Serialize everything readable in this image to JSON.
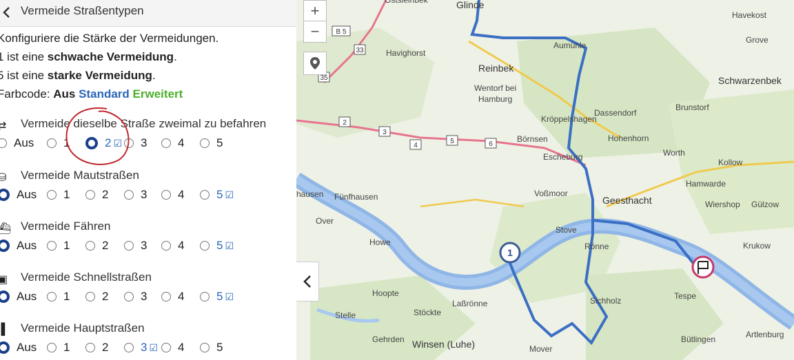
{
  "header": {
    "title": "Vermeide Straßentypen"
  },
  "intro": {
    "line1": "Konfiguriere die Stärke der Vermeidungen.",
    "line2_pre": "1 ist eine ",
    "line2_bold": "schwache Vermeidung",
    "line2_post": ".",
    "line3_pre": "5 ist eine ",
    "line3_bold": "starke Vermeidung",
    "line3_post": ".",
    "colorcode_label": "Farbcode: ",
    "colorcode_off": "Aus",
    "colorcode_standard": "Standard",
    "colorcode_extended": "Erweitert"
  },
  "sections": [
    {
      "title": "Vermeide dieselbe Straße zweimal zu befahren",
      "icon": "u-turn-icon",
      "selected": "2",
      "checked": "2",
      "options": [
        "Aus",
        "1",
        "2",
        "3",
        "4",
        "5"
      ]
    },
    {
      "title": "Vermeide Mautstraßen",
      "icon": "toll-icon",
      "selected": "Aus",
      "checked": "5",
      "options": [
        "Aus",
        "1",
        "2",
        "3",
        "4",
        "5"
      ]
    },
    {
      "title": "Vermeide Fähren",
      "icon": "ferry-icon",
      "selected": "Aus",
      "checked": "5",
      "options": [
        "Aus",
        "1",
        "2",
        "3",
        "4",
        "5"
      ]
    },
    {
      "title": "Vermeide Schnellstraßen",
      "icon": "car-icon",
      "selected": "Aus",
      "checked": "5",
      "options": [
        "Aus",
        "1",
        "2",
        "3",
        "4",
        "5"
      ]
    },
    {
      "title": "Vermeide Hauptstraßen",
      "icon": "road-icon",
      "selected": "Aus",
      "checked": "3",
      "options": [
        "Aus",
        "1",
        "2",
        "3",
        "4",
        "5"
      ]
    }
  ],
  "map": {
    "zoom_in": "+",
    "zoom_out": "−",
    "waypoint_label": "1",
    "places": [
      "Glinde",
      "Havekost",
      "Ostsieinbek",
      "Havighorst",
      "Aumühle",
      "Grove",
      "Reinbek",
      "Wentorf bei",
      "Hamburg",
      "Schwarzenbek",
      "Dassendorf",
      "Brunstorf",
      "Kröppelshagen",
      "Börnsen",
      "Hohenhorn",
      "Worth",
      "Kollow",
      "Escheburg",
      "Hamwarde",
      "Voßmoor",
      "Geesthacht",
      "Wiershop",
      "Gülzow",
      "hausen",
      "Fünfhausen",
      "Over",
      "Stove",
      "Rönne",
      "Krukow",
      "Howe",
      "Hoopte",
      "Laßrönne",
      "Tespe",
      "Stelle",
      "Stöckte",
      "Sichholz",
      "Gehrden",
      "Winsen (Luhe)",
      "Mover",
      "Bütlingen",
      "Artlenburg"
    ],
    "roads": [
      "B 5",
      "33",
      "35",
      "2",
      "3",
      "4",
      "5",
      "6"
    ]
  }
}
